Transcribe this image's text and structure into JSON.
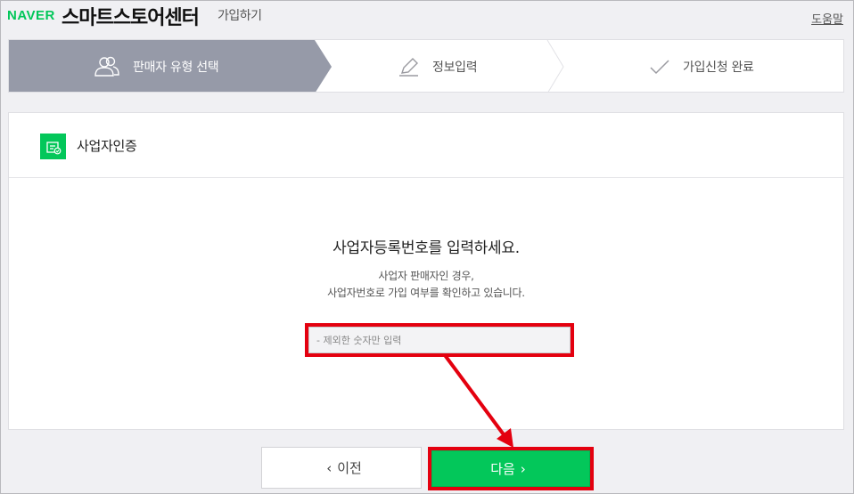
{
  "header": {
    "logo": "NAVER",
    "app_title": "스마트스토어센터",
    "subtitle": "가입하기",
    "help_link": "도움말"
  },
  "steps": [
    {
      "label": "판매자 유형 선택",
      "icon": "users-icon",
      "active": true
    },
    {
      "label": "정보입력",
      "icon": "pencil-icon",
      "active": false
    },
    {
      "label": "가입신청 완료",
      "icon": "check-icon",
      "active": false
    }
  ],
  "panel": {
    "title": "사업자인증",
    "icon": "business-verify-icon",
    "heading": "사업자등록번호를 입력하세요.",
    "desc_line1": "사업자 판매자인 경우,",
    "desc_line2": "사업자번호로 가입 여부를 확인하고 있습니다.",
    "input_placeholder": "- 제외한 숫자만 입력",
    "input_value": ""
  },
  "buttons": {
    "prev_label": "이전",
    "next_label": "다음"
  },
  "colors": {
    "accent_green": "#03c75a",
    "active_step": "#969aa8",
    "highlight_red": "#e4000f"
  }
}
